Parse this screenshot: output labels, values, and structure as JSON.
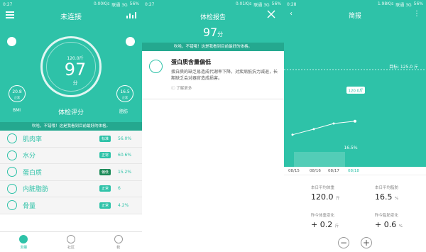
{
  "panel1": {
    "status": {
      "time": "0:27",
      "speed": "0.00K/s",
      "network": "联通 3G",
      "battery": "56%"
    },
    "title": "未连接",
    "weight": "120.0",
    "weight_unit": "斤",
    "score": "97",
    "score_unit": "分",
    "bmi_value": "20.8",
    "bmi_status": "正常",
    "bmi_label": "BMI",
    "fat_value": "16.5",
    "fat_status": "正常",
    "fat_label": "脂肪",
    "eval_label": "体检评分",
    "notice": "吹哈，不错哦！这是我看到目前最好的体格。",
    "metrics": [
      {
        "name": "肌肉率",
        "badge": "标准",
        "value": "56.0%"
      },
      {
        "name": "水分",
        "badge": "正常",
        "value": "60.6%"
      },
      {
        "name": "蛋白质",
        "badge": "偏低",
        "value": "15.2%"
      },
      {
        "name": "内脏脂肪",
        "badge": "正常",
        "value": "6"
      },
      {
        "name": "骨量",
        "badge": "正常",
        "value": "4.2%"
      }
    ],
    "tabs": [
      {
        "label": "测量"
      },
      {
        "label": "社区"
      },
      {
        "label": "我"
      }
    ]
  },
  "panel2": {
    "status": {
      "time": "0:27",
      "speed": "0.01K/s",
      "network": "联通 3G",
      "battery": "56%"
    },
    "title": "体检报告",
    "score": "97",
    "score_unit": "分",
    "notice": "吹哈，不错哦！这是我看到目前最好的体格。",
    "card_title": "蛋白质含量偏低",
    "card_text": "蛋白质的缺乏易造成代谢率下降，对疾病抵抗力减退，长期缺乏会对器官造成损害。",
    "more": "了解更多"
  },
  "panel3": {
    "status": {
      "time": "0:28",
      "speed": "1.98K/s",
      "network": "联通 3G",
      "battery": "56%"
    },
    "title": "简报",
    "target_label": "目标: 125.0 斤",
    "weight_bubble": "120.0斤",
    "fat_pct_label": "16.5%",
    "dates": [
      "08/15",
      "08/16",
      "08/17",
      "08/18"
    ],
    "stats": [
      {
        "label": "本日平均体重",
        "value": "120.0",
        "unit": "斤"
      },
      {
        "label": "本日平均脂肪",
        "value": "16.5",
        "unit": "%"
      },
      {
        "label": "昨今体重变化",
        "value": "+ 0.2",
        "unit": "斤"
      },
      {
        "label": "昨今脂肪变化",
        "value": "+ 0.6",
        "unit": "%"
      }
    ],
    "zoom_out": "−",
    "zoom_in": "+"
  },
  "colors": {
    "accent": "#2ec2a8",
    "accent_dark": "#24a88f",
    "low_badge": "#1c8a58"
  },
  "chart_data": {
    "type": "line",
    "x": [
      "08/15",
      "08/16",
      "08/17",
      "08/18"
    ],
    "series": [
      {
        "values": [
          118.8,
          119.3,
          119.8,
          120.0
        ]
      }
    ],
    "target": 125.0,
    "ylim": [
      115,
      127
    ]
  }
}
